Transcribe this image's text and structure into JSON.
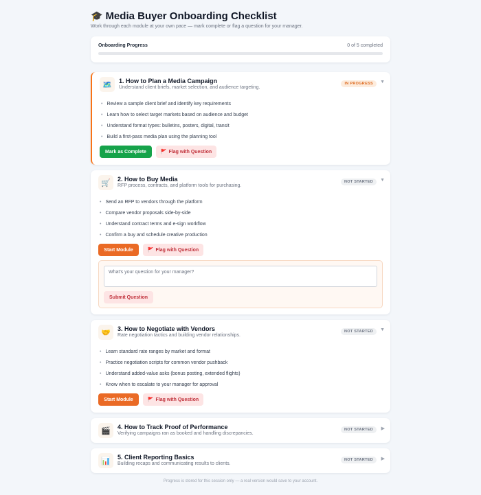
{
  "header": {
    "title_icon": "graduation-cap-icon",
    "title_glyph": "🎓",
    "title": "Media Buyer Onboarding Checklist",
    "subtitle": "Work through each module at your own pace — mark complete or flag a question for your manager."
  },
  "progress": {
    "label": "Onboarding Progress",
    "count_text": "0 of 5 completed",
    "completed": 0,
    "total": 5
  },
  "modules": [
    {
      "icon": "map-icon",
      "glyph": "🗺️",
      "title": "1. How to Plan a Media Campaign",
      "description": "Understand client briefs, market selection, and audience targeting.",
      "status": "IN PROGRESS",
      "expanded": true,
      "tasks": [
        "Review a sample client brief and identify key requirements",
        "Learn how to select target markets based on audience and budget",
        "Understand format types: bulletins, posters, digital, transit",
        "Build a first-pass media plan using the planning tool"
      ],
      "primary_label": "Mark as Complete",
      "flag_label": "Flag with Question"
    },
    {
      "icon": "shopping-cart-icon",
      "glyph": "🛒",
      "title": "2. How to Buy Media",
      "description": "RFP process, contracts, and platform tools for purchasing.",
      "status": "NOT STARTED",
      "expanded": true,
      "tasks": [
        "Send an RFP to vendors through the platform",
        "Compare vendor proposals side-by-side",
        "Understand contract terms and e-sign workflow",
        "Confirm a buy and schedule creative production"
      ],
      "primary_label": "Start Module",
      "flag_label": "Flag with Question",
      "question": {
        "placeholder": "What's your question for your manager?",
        "value": "",
        "submit_label": "Submit Question"
      }
    },
    {
      "icon": "handshake-icon",
      "glyph": "🤝",
      "title": "3. How to Negotiate with Vendors",
      "description": "Rate negotiation tactics and building vendor relationships.",
      "status": "NOT STARTED",
      "expanded": true,
      "tasks": [
        "Learn standard rate ranges by market and format",
        "Practice negotiation scripts for common vendor pushback",
        "Understand added-value asks (bonus posting, extended flights)",
        "Know when to escalate to your manager for approval"
      ],
      "primary_label": "Start Module",
      "flag_label": "Flag with Question"
    },
    {
      "icon": "clapperboard-icon",
      "glyph": "🎬",
      "title": "4. How to Track Proof of Performance",
      "description": "Verifying campaigns ran as booked and handling discrepancies.",
      "status": "NOT STARTED",
      "expanded": false
    },
    {
      "icon": "bar-chart-icon",
      "glyph": "📊",
      "title": "5. Client Reporting Basics",
      "description": "Building recaps and communicating results to clients.",
      "status": "NOT STARTED",
      "expanded": false
    }
  ],
  "flag_glyph": "🚩",
  "footer": "Progress is stored for this session only — a real version would save to your account.",
  "colors": {
    "accent_orange": "#ea6a25",
    "complete_green": "#16a34a",
    "flag_red": "#c0303a",
    "background": "#f3f6fa"
  }
}
